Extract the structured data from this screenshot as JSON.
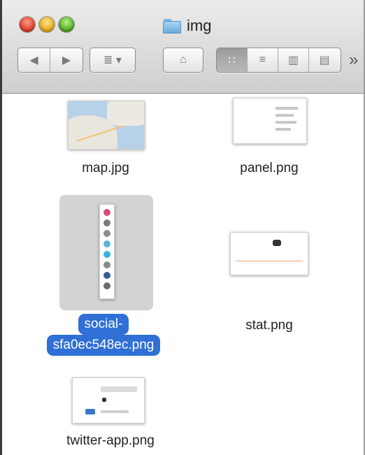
{
  "window": {
    "title": "img",
    "title_icon": "folder-icon"
  },
  "toolbar": {
    "back_icon": "◀",
    "forward_icon": "▶",
    "arrange_icon": "≣ ▾",
    "action_icon": "⌂",
    "view_icon_mode": "∷",
    "view_list_mode": "≡",
    "view_column_mode": "▥",
    "view_coverflow_mode": "▤",
    "overflow": "»"
  },
  "files": [
    {
      "name": "map.jpg",
      "type": "map"
    },
    {
      "name": "panel.png",
      "type": "panel"
    },
    {
      "name": "social-sfa0ec548ec.png",
      "name_line1": "social-",
      "name_line2": "sfa0ec548ec.png",
      "selected": true
    },
    {
      "name": "stat.png",
      "type": "stat"
    },
    {
      "name": "twitter-app.png",
      "type": "twitter"
    }
  ],
  "colors": {
    "selection_accent": "#2f6fd6",
    "selection_bg": "#d3d3d3"
  }
}
